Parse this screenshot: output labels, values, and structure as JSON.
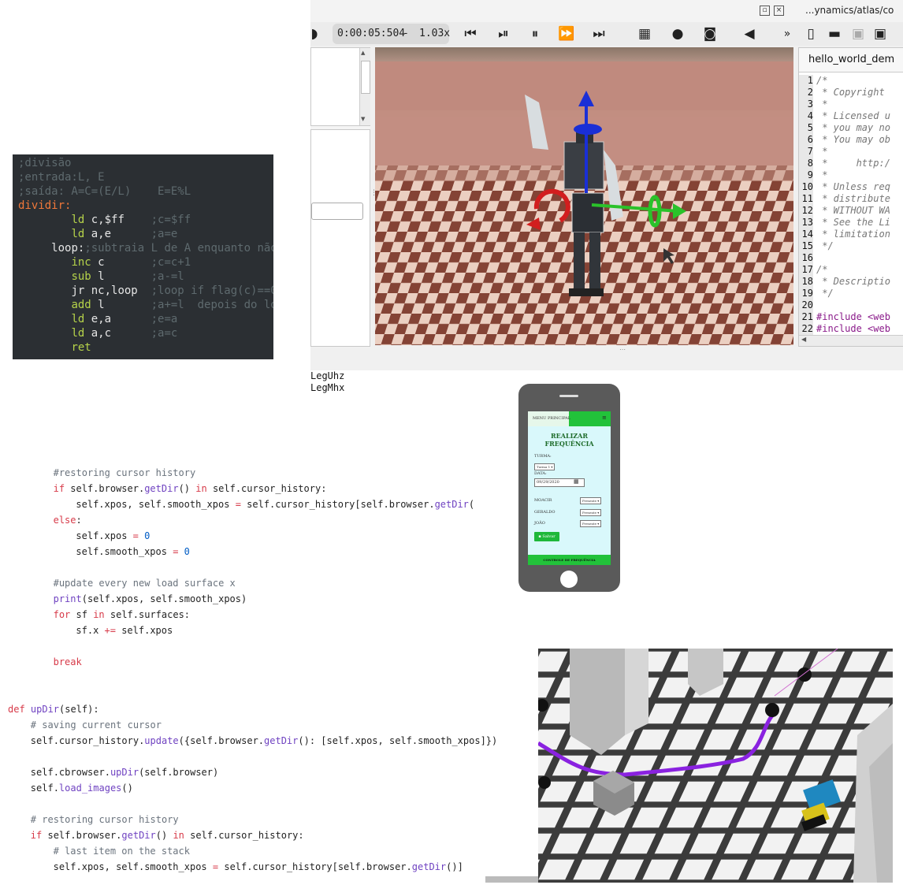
{
  "simulator": {
    "path": "...ynamics/atlas/co",
    "time": "0:00:05:504",
    "separator": "-",
    "speed": "1.03x",
    "toolbar_icons": [
      "step-back-icon",
      "play-step-icon",
      "pause-icon",
      "fast-forward-icon",
      "fastest-icon",
      "video-icon",
      "record-icon",
      "camera-icon",
      "mute-icon",
      "more-icon",
      "new-file-icon",
      "open-folder-icon",
      "save-icon",
      "save-as-icon"
    ],
    "more_label": "»",
    "editor_tab": "hello_world_dem",
    "editor_lines": [
      {
        "n": "1",
        "t": "/*"
      },
      {
        "n": "2",
        "t": " * Copyright"
      },
      {
        "n": "3",
        "t": " *"
      },
      {
        "n": "4",
        "t": " * Licensed u"
      },
      {
        "n": "5",
        "t": " * you may no"
      },
      {
        "n": "6",
        "t": " * You may ob"
      },
      {
        "n": "7",
        "t": " *"
      },
      {
        "n": "8",
        "t": " *     http:/"
      },
      {
        "n": "9",
        "t": " *"
      },
      {
        "n": "10",
        "t": " * Unless req"
      },
      {
        "n": "11",
        "t": " * distribute"
      },
      {
        "n": "12",
        "t": " * WITHOUT WA"
      },
      {
        "n": "13",
        "t": " * See the Li"
      },
      {
        "n": "14",
        "t": " * limitation"
      },
      {
        "n": "15",
        "t": " */"
      },
      {
        "n": "16",
        "t": ""
      },
      {
        "n": "17",
        "t": "/*"
      },
      {
        "n": "18",
        "t": " * Descriptio"
      },
      {
        "n": "19",
        "t": " */"
      },
      {
        "n": "20",
        "t": ""
      },
      {
        "n": "21",
        "t": "#include <web"
      },
      {
        "n": "22",
        "t": "#include <web"
      }
    ],
    "console_lines": [
      "LegUhz",
      "LegMhx"
    ]
  },
  "asm": {
    "lines": [
      {
        "indent": "",
        "parts": [
          {
            "c": "c-com",
            "t": ";divisão"
          }
        ]
      },
      {
        "indent": "",
        "parts": [
          {
            "c": "c-com",
            "t": ";entrada:L, E"
          }
        ]
      },
      {
        "indent": "",
        "parts": [
          {
            "c": "c-com",
            "t": ";saída: A=C=(E/L)    E=E%L"
          }
        ]
      },
      {
        "indent": "",
        "parts": [
          {
            "c": "c-lab",
            "t": "dividir:"
          }
        ]
      },
      {
        "indent": "        ",
        "parts": [
          {
            "c": "c-ins",
            "t": "ld "
          },
          {
            "c": "c-arg",
            "t": "c,$ff    "
          },
          {
            "c": "c-com",
            "t": ";c=$ff"
          }
        ]
      },
      {
        "indent": "        ",
        "parts": [
          {
            "c": "c-ins",
            "t": "ld "
          },
          {
            "c": "c-arg",
            "t": "a,e      "
          },
          {
            "c": "c-com",
            "t": ";a=e"
          }
        ]
      },
      {
        "indent": "     ",
        "parts": [
          {
            "c": "c-arg",
            "t": "loop:"
          },
          {
            "c": "c-com",
            "t": ";subtraia L de A enquanto não"
          }
        ]
      },
      {
        "indent": "        ",
        "parts": [
          {
            "c": "c-ins",
            "t": "inc "
          },
          {
            "c": "c-arg",
            "t": "c       "
          },
          {
            "c": "c-com",
            "t": ";c=c+1"
          }
        ]
      },
      {
        "indent": "        ",
        "parts": [
          {
            "c": "c-ins",
            "t": "sub "
          },
          {
            "c": "c-arg",
            "t": "l       "
          },
          {
            "c": "c-com",
            "t": ";a-=l"
          }
        ]
      },
      {
        "indent": "        ",
        "parts": [
          {
            "c": "c-arg",
            "t": "jr nc,loop  "
          },
          {
            "c": "c-com",
            "t": ";loop if flag(c)==0"
          }
        ]
      },
      {
        "indent": "        ",
        "parts": [
          {
            "c": "c-ins",
            "t": "add "
          },
          {
            "c": "c-arg",
            "t": "l       "
          },
          {
            "c": "c-com",
            "t": ";a+=l  depois do lo"
          }
        ]
      },
      {
        "indent": "        ",
        "parts": [
          {
            "c": "c-ins",
            "t": "ld "
          },
          {
            "c": "c-arg",
            "t": "e,a      "
          },
          {
            "c": "c-com",
            "t": ";e=a"
          }
        ]
      },
      {
        "indent": "        ",
        "parts": [
          {
            "c": "c-ins",
            "t": "ld "
          },
          {
            "c": "c-arg",
            "t": "a,c      "
          },
          {
            "c": "c-com",
            "t": ";a=c"
          }
        ]
      },
      {
        "indent": "        ",
        "parts": [
          {
            "c": "c-ins",
            "t": "ret"
          }
        ]
      }
    ]
  },
  "python": {
    "lines": [
      {
        "i": 1,
        "row": 0,
        "parts": [
          {
            "c": "cm",
            "t": "#restoring cursor history"
          }
        ]
      },
      {
        "i": 1,
        "row": 1,
        "parts": [
          {
            "c": "kw",
            "t": "if "
          },
          {
            "c": "",
            "t": "self.browser."
          },
          {
            "c": "fn",
            "t": "getDir"
          },
          {
            "c": "",
            "t": "() "
          },
          {
            "c": "kw",
            "t": "in "
          },
          {
            "c": "",
            "t": "self.cursor_history:"
          }
        ]
      },
      {
        "i": 2,
        "row": 2,
        "parts": [
          {
            "c": "",
            "t": "self.xpos, self.smooth_xpos "
          },
          {
            "c": "op",
            "t": "= "
          },
          {
            "c": "",
            "t": "self.cursor_history[self.browser."
          },
          {
            "c": "fn",
            "t": "getDir"
          },
          {
            "c": "",
            "t": "("
          }
        ]
      },
      {
        "i": 1,
        "row": 3,
        "parts": [
          {
            "c": "kw",
            "t": "else"
          },
          {
            "c": "",
            "t": ":"
          }
        ]
      },
      {
        "i": 2,
        "row": 4,
        "parts": [
          {
            "c": "",
            "t": "self.xpos "
          },
          {
            "c": "op",
            "t": "= "
          },
          {
            "c": "num",
            "t": "0"
          }
        ]
      },
      {
        "i": 2,
        "row": 5,
        "parts": [
          {
            "c": "",
            "t": "self.smooth_xpos "
          },
          {
            "c": "op",
            "t": "= "
          },
          {
            "c": "num",
            "t": "0"
          }
        ]
      },
      {
        "i": 1,
        "row": 7,
        "parts": [
          {
            "c": "cm",
            "t": "#update every new load surface x"
          }
        ]
      },
      {
        "i": 1,
        "row": 8,
        "parts": [
          {
            "c": "bi",
            "t": "print"
          },
          {
            "c": "",
            "t": "(self.xpos, self.smooth_xpos)"
          }
        ]
      },
      {
        "i": 1,
        "row": 9,
        "parts": [
          {
            "c": "kw",
            "t": "for "
          },
          {
            "c": "",
            "t": "sf "
          },
          {
            "c": "kw",
            "t": "in "
          },
          {
            "c": "",
            "t": "self.surfaces:"
          }
        ]
      },
      {
        "i": 2,
        "row": 10,
        "parts": [
          {
            "c": "",
            "t": "sf.x "
          },
          {
            "c": "op",
            "t": "+= "
          },
          {
            "c": "",
            "t": "self.xpos"
          }
        ]
      },
      {
        "i": 1,
        "row": 12,
        "parts": [
          {
            "c": "kw",
            "t": "break"
          }
        ]
      },
      {
        "i": -1,
        "row": 15,
        "parts": [
          {
            "c": "kw",
            "t": "def "
          },
          {
            "c": "fn",
            "t": "upDir"
          },
          {
            "c": "",
            "t": "(self):"
          }
        ]
      },
      {
        "i": 0,
        "row": 16,
        "parts": [
          {
            "c": "cm",
            "t": "# saving current cursor"
          }
        ]
      },
      {
        "i": 0,
        "row": 17,
        "parts": [
          {
            "c": "",
            "t": "self.cursor_history."
          },
          {
            "c": "fn",
            "t": "update"
          },
          {
            "c": "",
            "t": "({self.browser."
          },
          {
            "c": "fn",
            "t": "getDir"
          },
          {
            "c": "",
            "t": "(): [self.xpos, self.smooth_xpos]})"
          }
        ]
      },
      {
        "i": 0,
        "row": 19,
        "parts": [
          {
            "c": "",
            "t": "self.cbrowser."
          },
          {
            "c": "fn",
            "t": "upDir"
          },
          {
            "c": "",
            "t": "(self.browser)"
          }
        ]
      },
      {
        "i": 0,
        "row": 20,
        "parts": [
          {
            "c": "",
            "t": "self."
          },
          {
            "c": "fn",
            "t": "load_images"
          },
          {
            "c": "",
            "t": "()"
          }
        ]
      },
      {
        "i": 0,
        "row": 22,
        "parts": [
          {
            "c": "cm",
            "t": "# restoring cursor history"
          }
        ]
      },
      {
        "i": 0,
        "row": 23,
        "parts": [
          {
            "c": "kw",
            "t": "if "
          },
          {
            "c": "",
            "t": "self.browser."
          },
          {
            "c": "fn",
            "t": "getDir"
          },
          {
            "c": "",
            "t": "() "
          },
          {
            "c": "kw",
            "t": "in "
          },
          {
            "c": "",
            "t": "self.cursor_history:"
          }
        ]
      },
      {
        "i": 1,
        "row": 24,
        "parts": [
          {
            "c": "cm",
            "t": "# last item on the stack"
          }
        ]
      },
      {
        "i": 1,
        "row": 25,
        "parts": [
          {
            "c": "",
            "t": "self.xpos, self.smooth_xpos "
          },
          {
            "c": "op",
            "t": "= "
          },
          {
            "c": "",
            "t": "self.cursor_history[self.browser."
          },
          {
            "c": "fn",
            "t": "getDir"
          },
          {
            "c": "",
            "t": "()]"
          }
        ]
      }
    ]
  },
  "phone": {
    "menu": "MENU PRINCIPAL",
    "menu_icon": "≡",
    "title": "REALIZAR FREQUÊNCIA",
    "turma_label": "TURMA:",
    "turma_value": "Turma 1 ▾",
    "data_label": "DATA:",
    "data_value": "09/29/2020",
    "students": [
      {
        "name": "MOACIR",
        "status": "Presente ▾"
      },
      {
        "name": "GERALDO",
        "status": "Presente ▾"
      },
      {
        "name": "JOÃO",
        "status": "Presente ▾"
      }
    ],
    "save": "Salvar",
    "footer": "CONTROLE DE FREQUÊNCIA"
  }
}
